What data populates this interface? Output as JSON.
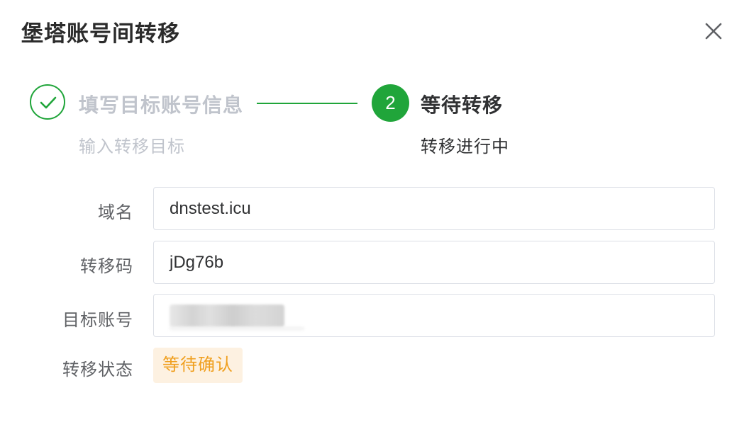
{
  "dialog": {
    "title": "堡塔账号间转移",
    "close_icon": "close-icon"
  },
  "steps": [
    {
      "title": "填写目标账号信息",
      "description": "输入转移目标",
      "status": "done",
      "icon": "check-icon"
    },
    {
      "number": "2",
      "title": "等待转移",
      "description": "转移进行中",
      "status": "active"
    }
  ],
  "form": {
    "domain": {
      "label": "域名",
      "value": "dnstest.icu"
    },
    "transfer_code": {
      "label": "转移码",
      "value": "jDg76b"
    },
    "target_account": {
      "label": "目标账号",
      "value_state": "blurred"
    },
    "transfer_status": {
      "label": "转移状态",
      "value": "等待确认"
    }
  },
  "colors": {
    "primary": "#20a53a",
    "warning_text": "#f0a020",
    "warning_bg": "#fdf1e1",
    "muted": "#c0c4cc"
  }
}
